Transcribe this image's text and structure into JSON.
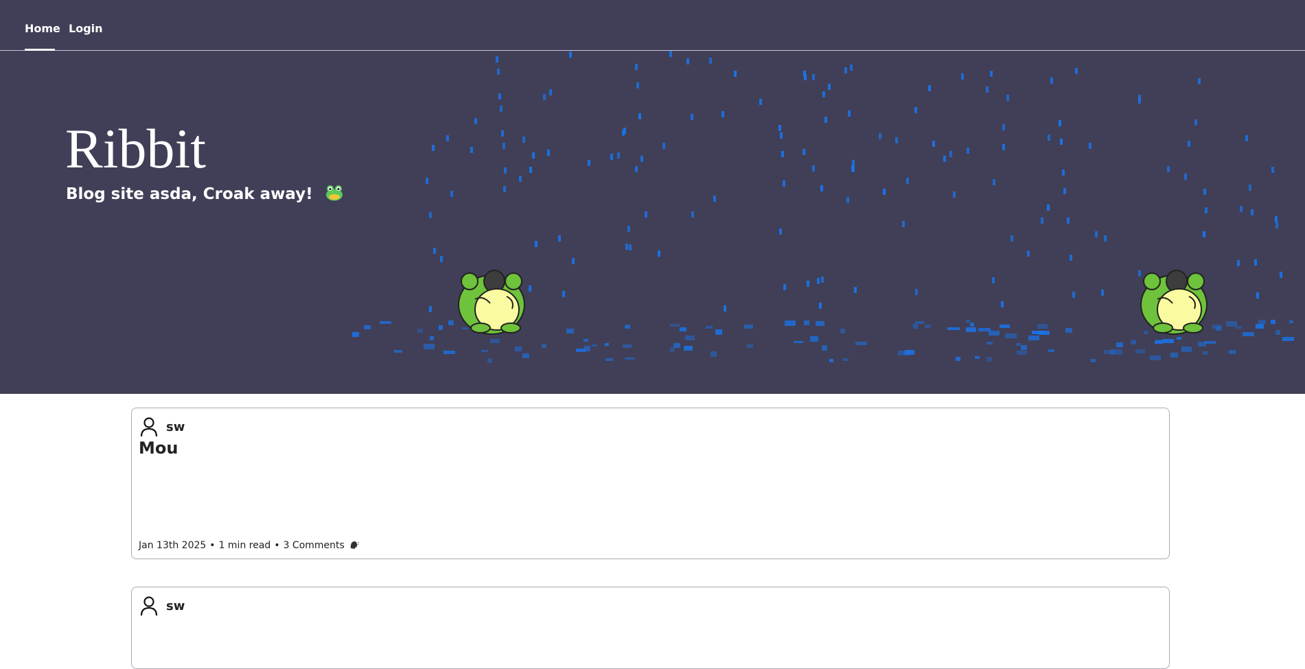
{
  "nav": {
    "home_label": "Home",
    "login_label": "Login"
  },
  "hero": {
    "title": "Ribbit",
    "subtitle": "Blog site asda, Croak away!",
    "subtitle_emoji": "frog-face-emoji",
    "background_color": "#403f57",
    "rain_color": "#1a73e8"
  },
  "posts": [
    {
      "author": "sw",
      "title": "Mou",
      "date": "Jan 13th 2025",
      "read_time": "1 min read",
      "comments": "3 Comments",
      "comments_icon": "speaking-head-icon",
      "separator": "•"
    },
    {
      "author": "sw"
    }
  ]
}
